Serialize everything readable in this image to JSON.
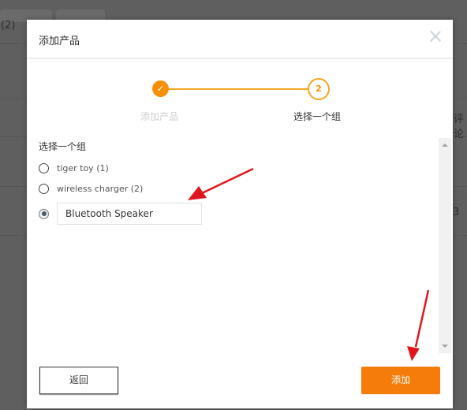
{
  "background": {
    "partial_tab_text": "(2)",
    "partial_col_header": "评论",
    "partial_cell_value": "3"
  },
  "modal": {
    "title": "添加产品",
    "close_icon": "close-icon",
    "steps": [
      {
        "number": "1",
        "label": "添加产品",
        "status": "completed",
        "icon": "check-icon"
      },
      {
        "number": "2",
        "label": "选择一个组",
        "status": "active"
      }
    ],
    "section_title": "选择一个组",
    "groups": [
      {
        "label": "tiger toy (1)",
        "selected": false
      },
      {
        "label": "wireless charger (2)",
        "selected": false
      }
    ],
    "new_group": {
      "selected": true,
      "value": "Bluetooth Speaker",
      "placeholder": ""
    },
    "buttons": {
      "back": "返回",
      "add": "添加"
    }
  },
  "colors": {
    "accent": "#f57c0b",
    "annotation_arrow": "#e0161e"
  }
}
